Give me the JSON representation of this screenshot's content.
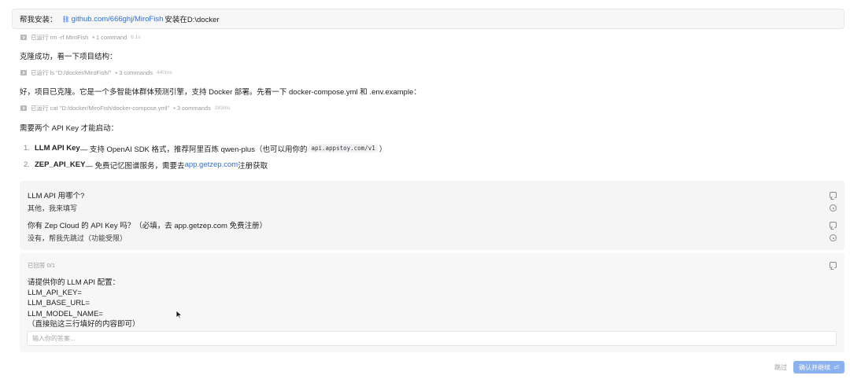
{
  "user_message": {
    "prefix": "帮我安装：",
    "link_icon": "link-icon",
    "link_text": "github.com/666ghj/MiroFish",
    "suffix": " 安装在D:\\docker"
  },
  "tool_runs": [
    {
      "label": "已运行 rm -rf MiroFish",
      "count": "• 1 command",
      "duration": "6.1s"
    },
    {
      "label": "已运行 ls \"D:/docker/MiroFish/\"",
      "count": "• 3 commands",
      "duration": "440ms"
    },
    {
      "label": "已运行 cat \"D:/docker/MiroFish/docker-compose.yml\"",
      "count": "• 3 commands",
      "duration": "283ms"
    }
  ],
  "paragraphs": {
    "clone_done": "克隆成功，看一下项目结构：",
    "intro": "好，项目已克隆。它是一个多智能体群体预测引擎，支持 Docker 部署。先看一下 docker-compose.yml 和 .env.example：",
    "need_keys": "需要两个 API Key 才能启动："
  },
  "steps": [
    {
      "num": "1.",
      "title": "LLM API Key",
      "text": " — 支持 OpenAI SDK 格式，推荐阿里百炼 qwen-plus（也可以用你的 ",
      "code": "api.appstoy.com/v1",
      "tail": "）"
    },
    {
      "num": "2.",
      "title": "ZEP_API_KEY",
      "text": " — 免费记忆图谱服务，需要去 ",
      "link": "app.getzep.com",
      "tail": " 注册获取"
    }
  ],
  "questions": [
    {
      "question": "LLM API 用哪个?",
      "answer": "其他，我来填写"
    },
    {
      "question": "你有 Zep Cloud 的 API Key 吗？（必填，去 app.getzep.com 免费注册）",
      "answer": "没有，帮我先跳过（功能受限）"
    }
  ],
  "answer_panel": {
    "status": "已回答 0/1",
    "prompt": "请提供你的 LLM API 配置：\nLLM_API_KEY=\nLLM_BASE_URL=\nLLM_MODEL_NAME=\n（直接贴这三行填好的内容即可）",
    "input_placeholder": "输入你的答案..."
  },
  "footer": {
    "skip_label": "跳过",
    "confirm_label": "确认并继续",
    "confirm_icon": "enter-icon"
  }
}
